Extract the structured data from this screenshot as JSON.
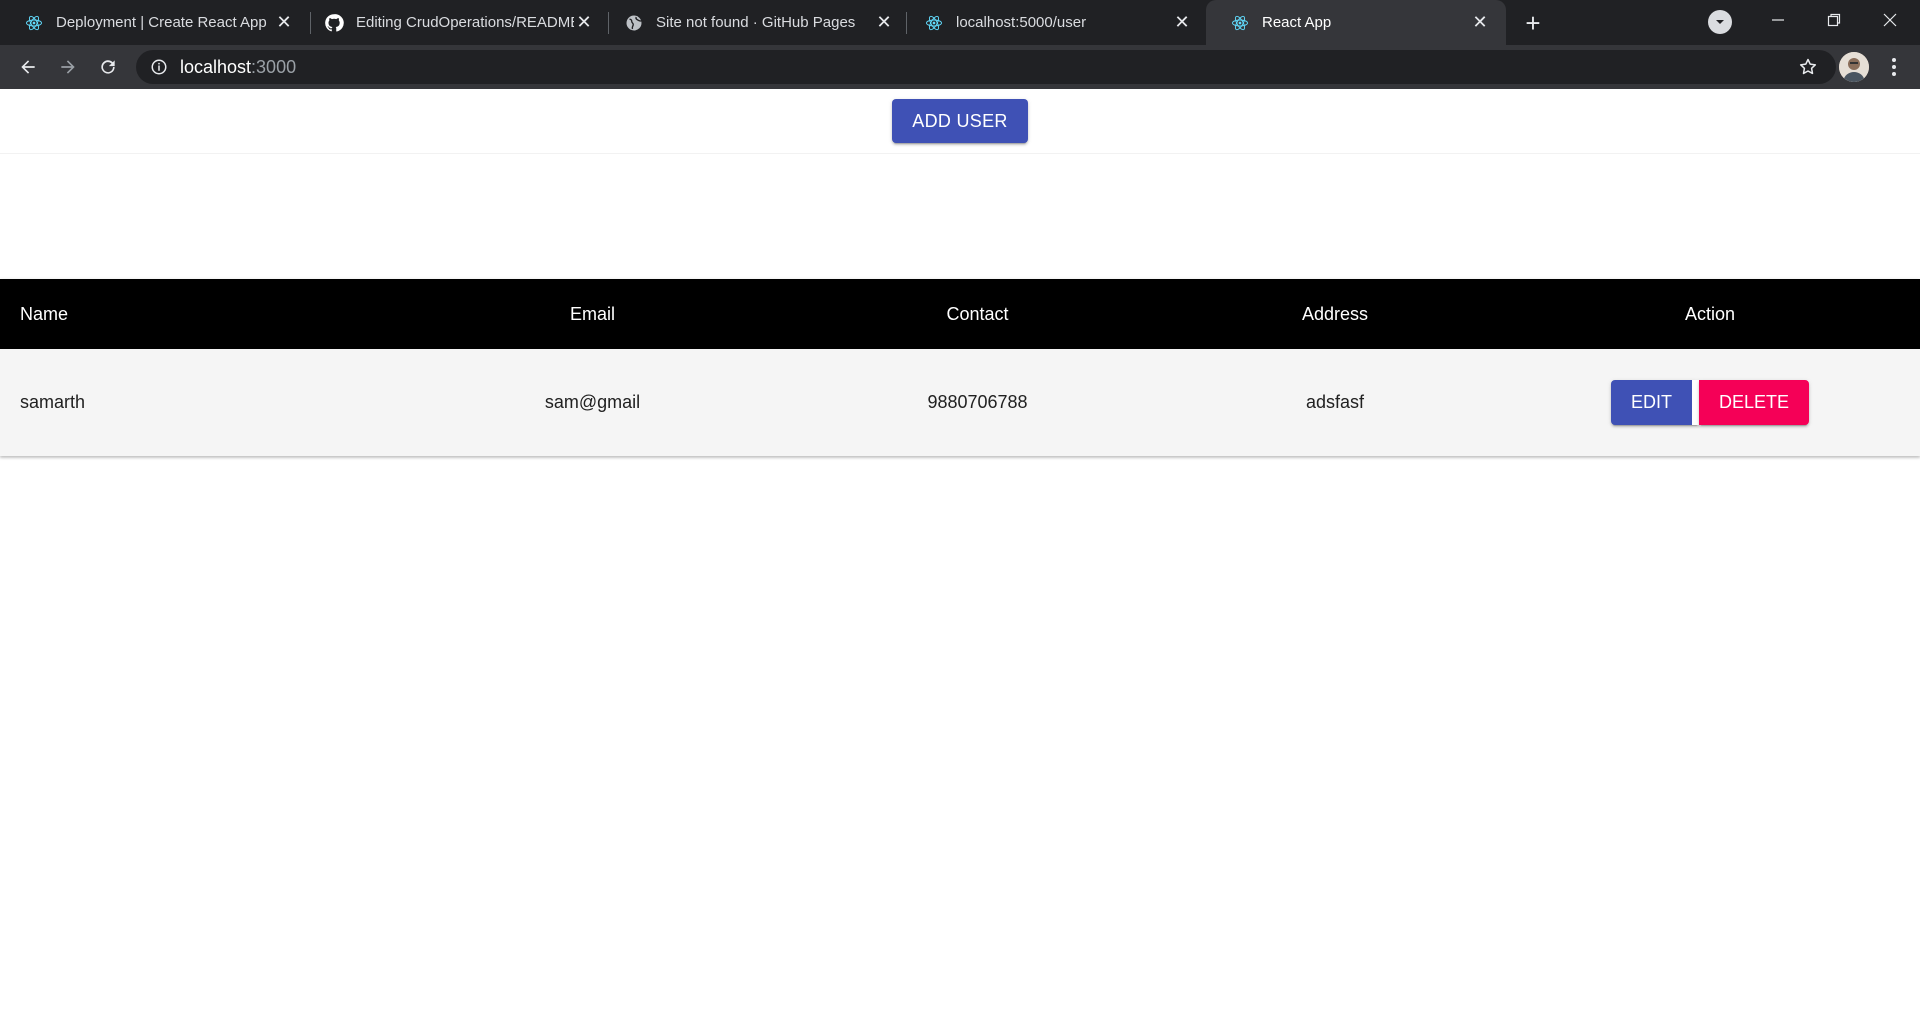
{
  "browser": {
    "tabs": [
      {
        "title": "Deployment | Create React App",
        "icon": "react-icon",
        "active": false
      },
      {
        "title": "Editing CrudOperations/README.md",
        "icon": "github-icon",
        "active": false
      },
      {
        "title": "Site not found · GitHub Pages",
        "icon": "globe-icon",
        "active": false
      },
      {
        "title": "localhost:5000/user",
        "icon": "react-icon",
        "active": false
      },
      {
        "title": "React App",
        "icon": "react-icon",
        "active": true
      }
    ],
    "address": {
      "host": "localhost",
      "port": ":3000"
    }
  },
  "page": {
    "add_user_label": "ADD USER",
    "table": {
      "headers": [
        "Name",
        "Email",
        "Contact",
        "Address",
        "Action"
      ],
      "rows": [
        {
          "name": "samarth",
          "email": "sam@gmail",
          "contact": "9880706788",
          "address": "adsfasf"
        }
      ],
      "edit_label": "EDIT",
      "delete_label": "DELETE"
    }
  },
  "colors": {
    "primary": "#3f51b5",
    "secondary": "#f50057",
    "header_bg": "#000000",
    "row_bg": "#f5f5f5"
  }
}
